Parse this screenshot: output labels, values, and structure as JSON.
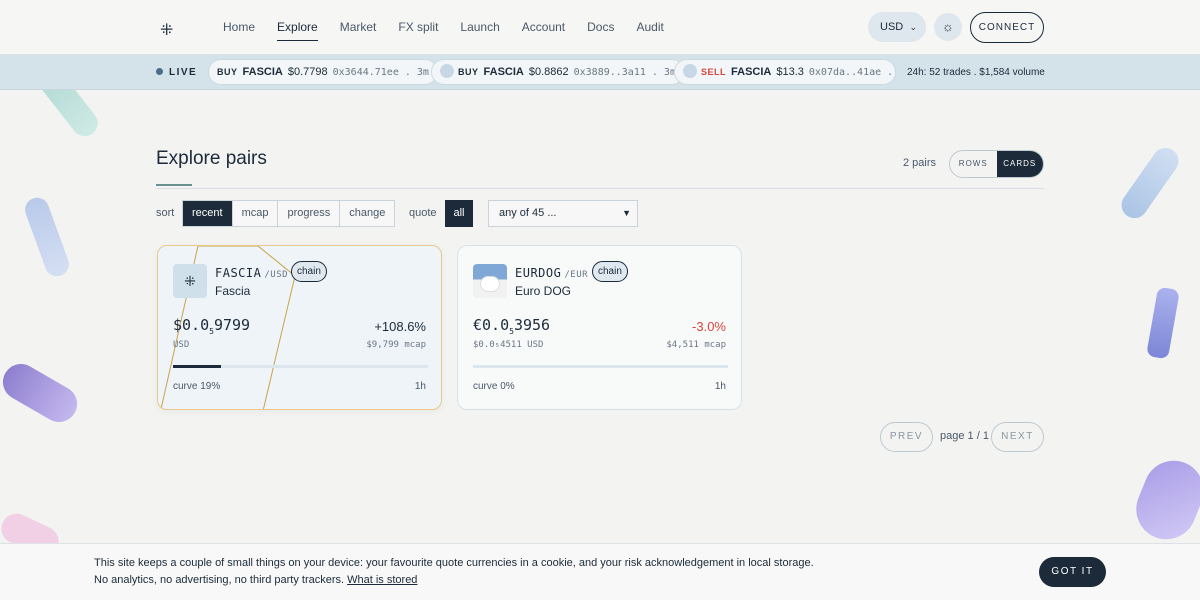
{
  "header": {
    "logo": "⁜",
    "nav": [
      {
        "label": "Home",
        "active": false
      },
      {
        "label": "Explore",
        "active": true
      },
      {
        "label": "Market",
        "active": false
      },
      {
        "label": "FX split",
        "active": false
      },
      {
        "label": "Launch",
        "active": false
      },
      {
        "label": "Account",
        "active": false
      },
      {
        "label": "Docs",
        "active": false
      },
      {
        "label": "Audit",
        "active": false
      }
    ],
    "currency": "USD",
    "currency_icon": "chevron-down-icon",
    "theme_icon": "sun-icon",
    "connect_label": "CONNECT"
  },
  "ticker": {
    "live_label": "LIVE",
    "trades": [
      {
        "side": "BUY",
        "symbol": "FASCIA",
        "price": "$0.7798",
        "addr": "0x3644.71ee . 3m"
      },
      {
        "side": "BUY",
        "symbol": "FASCIA",
        "price": "$0.8862",
        "addr": "0x3889..3a11 . 3m"
      },
      {
        "side": "SELL",
        "symbol": "FASCIA",
        "price": "$13.3",
        "addr": "0x07da..41ae . 4m"
      }
    ],
    "stats": "24h: 52 trades . $1,584 volume"
  },
  "main": {
    "title": "Explore pairs",
    "count": "2 pairs",
    "view_rows": "ROWS",
    "view_cards": "CARDS",
    "sort_label": "sort",
    "sort_options": [
      "recent",
      "mcap",
      "progress",
      "change"
    ],
    "quote_label": "quote",
    "quote_all": "all",
    "quote_select": "any of 45 ..."
  },
  "cards": [
    {
      "symbol": "FASCIA",
      "quote": "/USD",
      "chain": "chain",
      "name": "Fascia",
      "price_pre": "$0.0",
      "price_sub": "5",
      "price_post": "9799",
      "price_unit": "USD",
      "change": "+108.6%",
      "mcap": "$9,799 mcap",
      "progress": 0.19,
      "curve": "curve 19%",
      "age": "1h"
    },
    {
      "symbol": "EURDOG",
      "quote": "/EUR",
      "chain": "chain",
      "name": "Euro DOG",
      "price_pre": "€0.0",
      "price_sub": "5",
      "price_post": "3956",
      "price_unit": "$0.0₅4511 USD",
      "change": "-3.0%",
      "mcap": "$4,511 mcap",
      "progress": 0.0,
      "curve": "curve 0%",
      "age": "1h"
    }
  ],
  "pagination": {
    "prev": "PREV",
    "info": "page 1 / 1",
    "next": "NEXT"
  },
  "cookie": {
    "text": "This site keeps a couple of small things on your device: your favourite quote currencies in a cookie, and your risk acknowledgement in local storage. No analytics, no advertising, no third party trackers.",
    "link": "What is stored",
    "button": "GOT IT"
  },
  "colors": {
    "accent": "#1c2a3a",
    "negative": "#d8453a",
    "ticker_bg": "#d4e2ea",
    "highlight_border": "#e8c98a"
  }
}
